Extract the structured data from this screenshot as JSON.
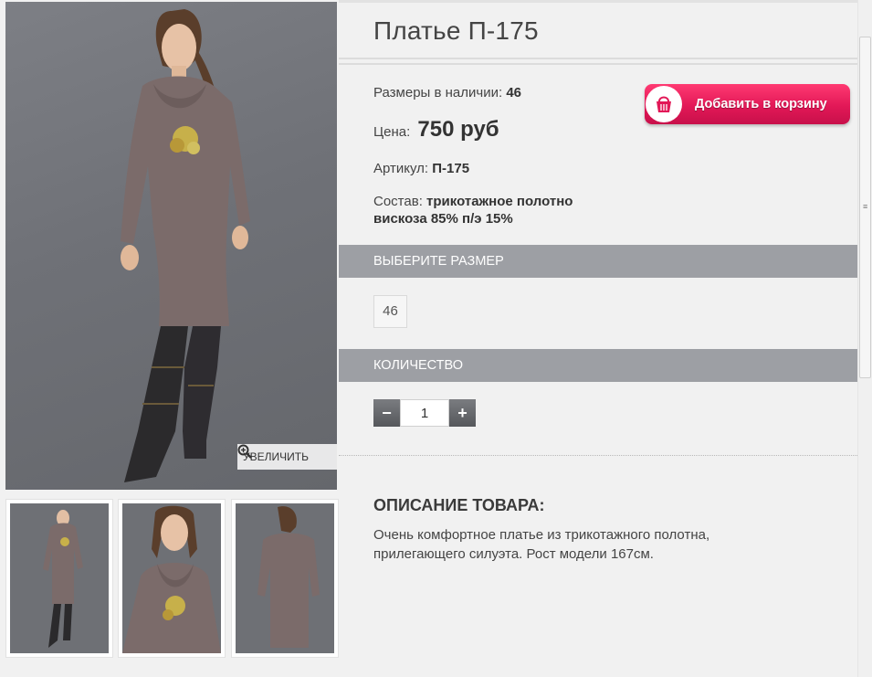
{
  "product": {
    "title": "Платье П-175",
    "sizes_label": "Размеры в наличии:",
    "sizes_value": "46",
    "price_label": "Цена:",
    "price_value": "750 руб",
    "article_label": "Артикул:",
    "article_value": "П-175",
    "composition_label": "Состав:",
    "composition_line1": "трикотажное полотно",
    "composition_line2": "вискоза 85% п/э 15%"
  },
  "cart_button": {
    "label": "Добавить в корзину",
    "icon": "basket-icon"
  },
  "gallery": {
    "zoom_label": "УВЕЛИЧИТЬ",
    "zoom_icon": "magnifier-icon"
  },
  "sections": {
    "choose_size": "ВЫБЕРИТЕ РАЗМЕР",
    "quantity": "КОЛИЧЕСТВО"
  },
  "size_options": [
    "46"
  ],
  "quantity": {
    "minus": "−",
    "value": "1",
    "plus": "+"
  },
  "description": {
    "title": "ОПИСАНИЕ ТОВАРА:",
    "text": "Очень комфортное платье из трикотажного полотна, прилегающего силуэта. Рост модели 167см."
  },
  "colors": {
    "accent": "#e21857",
    "section_bar": "#9d9fa4",
    "dress": "#7b6b6a"
  }
}
